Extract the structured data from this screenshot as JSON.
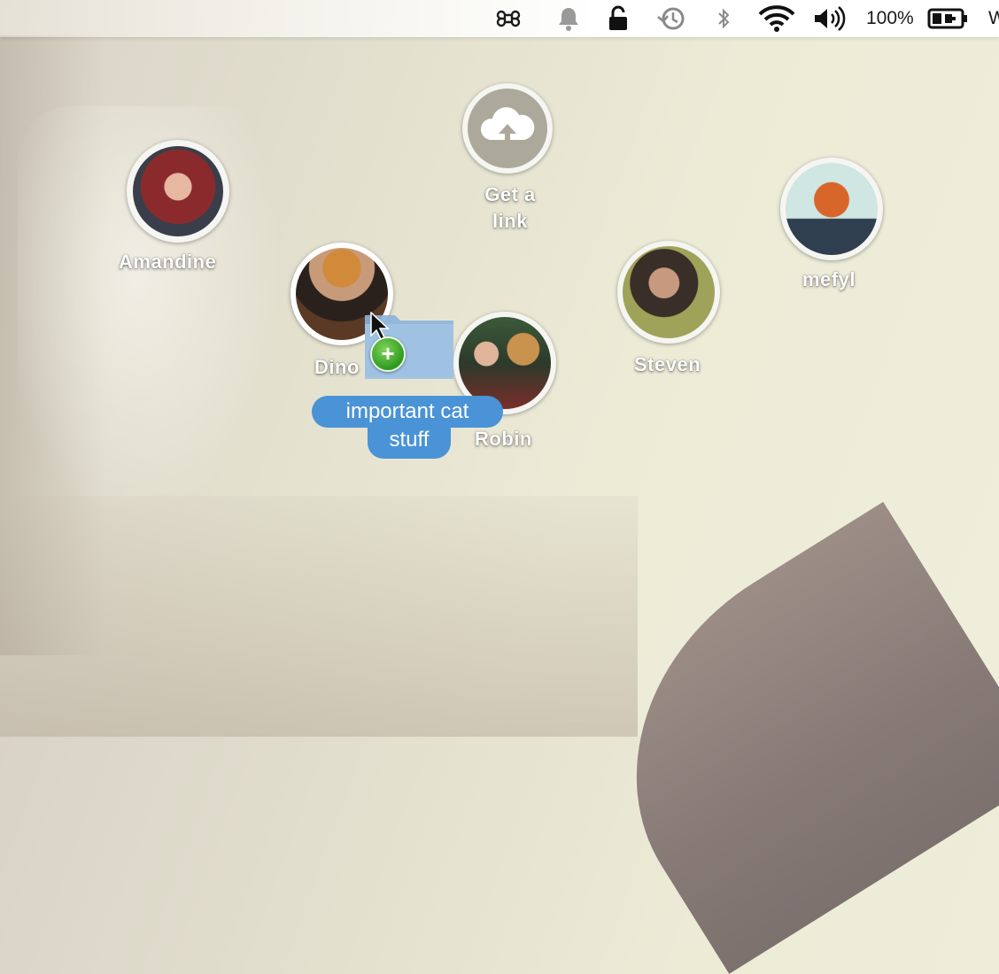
{
  "menubar": {
    "icons": [
      "command-key-icon",
      "notification-bell-icon",
      "lock-icon",
      "time-machine-icon",
      "bluetooth-icon",
      "wifi-icon",
      "volume-icon",
      "battery-icon"
    ],
    "battery_percent": "100%",
    "clock_partial": "W"
  },
  "share_targets": {
    "get_link_line1": "Get a",
    "get_link_line2": "link",
    "contacts": [
      {
        "name": "Amandine"
      },
      {
        "name": "Dino"
      },
      {
        "name": "Robin"
      },
      {
        "name": "Steven"
      },
      {
        "name": "mefyl"
      }
    ]
  },
  "drag": {
    "item_line1": "important cat",
    "item_line2": "stuff",
    "badge": "+"
  },
  "colors": {
    "drag_label_bg": "#4a93d6",
    "add_badge": "#2e9a1f",
    "get_link_bg": "#aca99b"
  }
}
